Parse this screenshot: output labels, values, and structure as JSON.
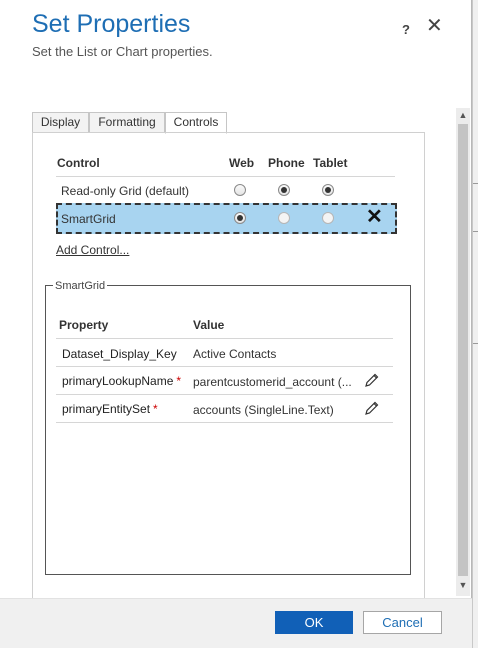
{
  "dialog": {
    "title": "Set Properties",
    "subtitle": "Set the List or Chart properties.",
    "help_label": "?",
    "close_label": "✕"
  },
  "tabs": [
    {
      "label": "Display",
      "active": false
    },
    {
      "label": "Formatting",
      "active": false
    },
    {
      "label": "Controls",
      "active": true
    }
  ],
  "controls_table": {
    "headers": {
      "control": "Control",
      "web": "Web",
      "phone": "Phone",
      "tablet": "Tablet"
    },
    "rows": [
      {
        "name": "Read-only Grid (default)",
        "web": false,
        "phone": true,
        "tablet": true
      },
      {
        "name": "SmartGrid",
        "web": true,
        "phone": false,
        "tablet": false,
        "selected": true
      }
    ],
    "remove_label": "✕",
    "add_control_label": "Add Control..."
  },
  "smartgrid": {
    "legend": "SmartGrid",
    "headers": {
      "property": "Property",
      "value": "Value"
    },
    "rows": [
      {
        "name": "Dataset_Display_Key",
        "required": false,
        "value": "Active Contacts",
        "editable": false
      },
      {
        "name": "primaryLookupName",
        "required": true,
        "value": "parentcustomerid_account (...",
        "editable": true
      },
      {
        "name": "primaryEntitySet",
        "required": true,
        "value": "accounts (SingleLine.Text)",
        "editable": true
      }
    ],
    "required_mark": "*"
  },
  "footer": {
    "ok_label": "OK",
    "cancel_label": "Cancel"
  },
  "colors": {
    "title": "#1e6eb4",
    "selected_row": "#a8d4f0",
    "ok_button": "#1160b7",
    "required": "#cc0000"
  },
  "icons": {
    "edit": "pencil-icon",
    "remove": "close-icon"
  }
}
